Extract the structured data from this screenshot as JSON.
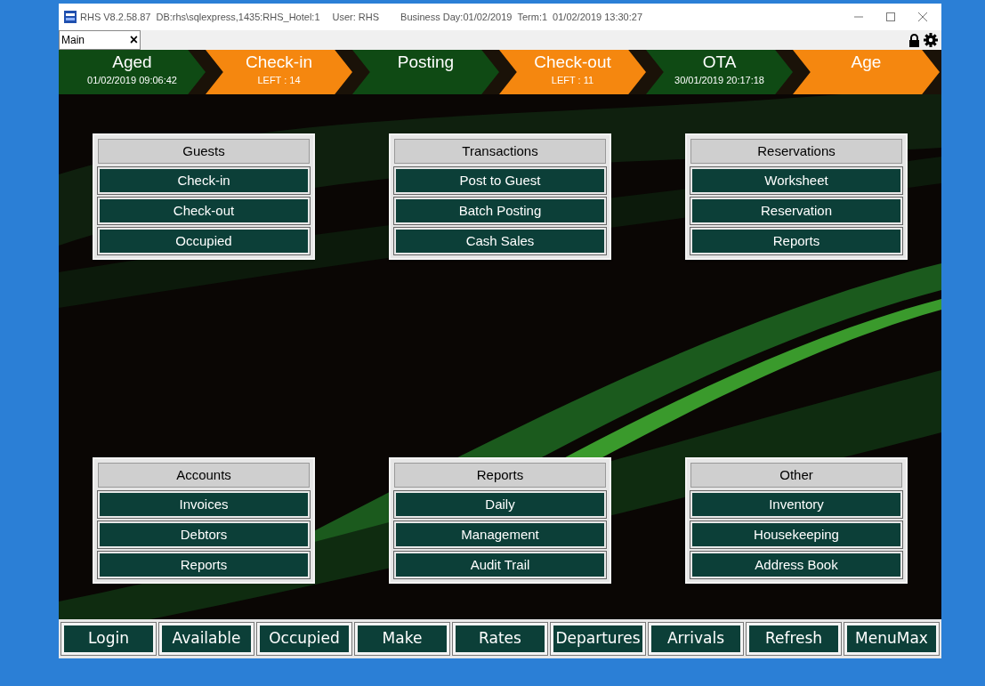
{
  "window": {
    "title": "RHS V8.2.58.87",
    "db": "DB:rhs\\sqlexpress,1435:RHS_Hotel:1",
    "user": "User: RHS",
    "business_day": "Business Day:01/02/2019",
    "term": "Term:1",
    "datetime": "01/02/2019 13:30:27"
  },
  "tabs": [
    {
      "label": "Main",
      "close": "×",
      "selected": true
    }
  ],
  "status_chevrons": [
    {
      "title": "Aged",
      "detail": "01/02/2019 09:06:42",
      "color": "#0f4a14"
    },
    {
      "title": "Check-in",
      "detail": "LEFT : 14",
      "color": "#f5870f"
    },
    {
      "title": "Posting",
      "color": "#0f4a14"
    },
    {
      "title": "Check-out",
      "detail": "LEFT : 11",
      "color": "#f5870f"
    },
    {
      "title": "OTA",
      "detail": "30/01/2019 20:17:18",
      "color": "#0f4a14"
    },
    {
      "title": "Age",
      "color": "#f5870f"
    }
  ],
  "panels": [
    {
      "title": "Guests",
      "buttons": [
        "Check-in",
        "Check-out",
        "Occupied"
      ]
    },
    {
      "title": "Transactions",
      "buttons": [
        "Post to Guest",
        "Batch Posting",
        "Cash Sales"
      ]
    },
    {
      "title": "Reservations",
      "buttons": [
        "Worksheet",
        "Reservation",
        "Reports"
      ]
    },
    {
      "title": "Accounts",
      "buttons": [
        "Invoices",
        "Debtors",
        "Reports"
      ]
    },
    {
      "title": "Reports",
      "buttons": [
        "Daily",
        "Management",
        "Audit Trail"
      ]
    },
    {
      "title": "Other",
      "buttons": [
        "Inventory",
        "Housekeeping",
        "Address Book"
      ]
    }
  ],
  "bottom_buttons": [
    "Login",
    "Available",
    "Occupied",
    "Make",
    "Rates",
    "Departures",
    "Arrivals",
    "Refresh",
    "MenuMax"
  ]
}
